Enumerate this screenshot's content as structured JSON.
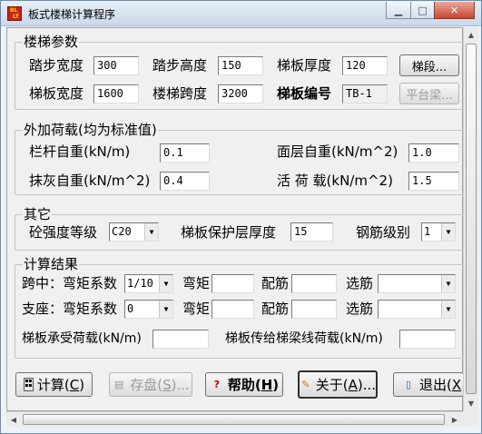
{
  "window": {
    "title": "板式楼梯计算程序",
    "icon_text_top": "BL",
    "icon_text_bottom": "LT",
    "minimize_glyph": "▁",
    "maximize_glyph": "□",
    "close_glyph": "✕"
  },
  "stair_params": {
    "title": "楼梯参数",
    "step_width_label": "踏步宽度",
    "step_width_value": "300",
    "step_height_label": "踏步高度",
    "step_height_value": "150",
    "slab_thickness_label": "梯板厚度",
    "slab_thickness_value": "120",
    "segment_button": "梯段...",
    "slab_width_label": "梯板宽度",
    "slab_width_value": "1600",
    "span_label": "楼梯跨度",
    "span_value": "3200",
    "code_label": "梯板编号",
    "code_value": "TB-1",
    "platform_button": "平台梁..."
  },
  "loads": {
    "title": "外加荷载(均为标准值)",
    "railing_label": "栏杆自重(kN/m)",
    "railing_value": "0.1",
    "surface_label": "面层自重(kN/m^2)",
    "surface_value": "1.0",
    "plaster_label": "抹灰自重(kN/m^2)",
    "plaster_value": "0.4",
    "live_label": "活 荷 载(kN/m^2)",
    "live_value": "1.5"
  },
  "other": {
    "title": "其它",
    "concrete_label": "砼强度等级",
    "concrete_value": "C20",
    "cover_label": "梯板保护层厚度",
    "cover_value": "15",
    "rebar_label": "钢筋级别",
    "rebar_value": "1"
  },
  "results": {
    "title": "计算结果",
    "midspan_label": "跨中：弯矩系数",
    "midspan_coef": "1/10",
    "support_label": "支座：弯矩系数",
    "support_coef": "0",
    "moment_label": "弯矩",
    "rebar_label": "配筋",
    "select_label": "选筋",
    "slab_load_label": "梯板承受荷载(kN/m)",
    "transfer_load_label": "梯板传给梯梁线荷载(kN/m)"
  },
  "buttons": {
    "calculate": "计算(",
    "calculate_key": "C",
    "save": "存盘(",
    "save_key": "S",
    "save_suffix": ")...",
    "help": "帮助(",
    "help_key": "H",
    "about": "关于(",
    "about_key": "A",
    "about_suffix": ")...",
    "exit": "退出(",
    "exit_key": "X",
    "close_paren": ")"
  },
  "colors": {
    "title_bar": "#dbe6f2",
    "close_button": "#c9452f",
    "dialog_bg": "#f0f0f0"
  },
  "icons": {
    "calculate": "calculator-icon",
    "save": "save-disk-icon",
    "help": "help-icon",
    "about": "about-icon",
    "exit": "exit-door-icon"
  }
}
